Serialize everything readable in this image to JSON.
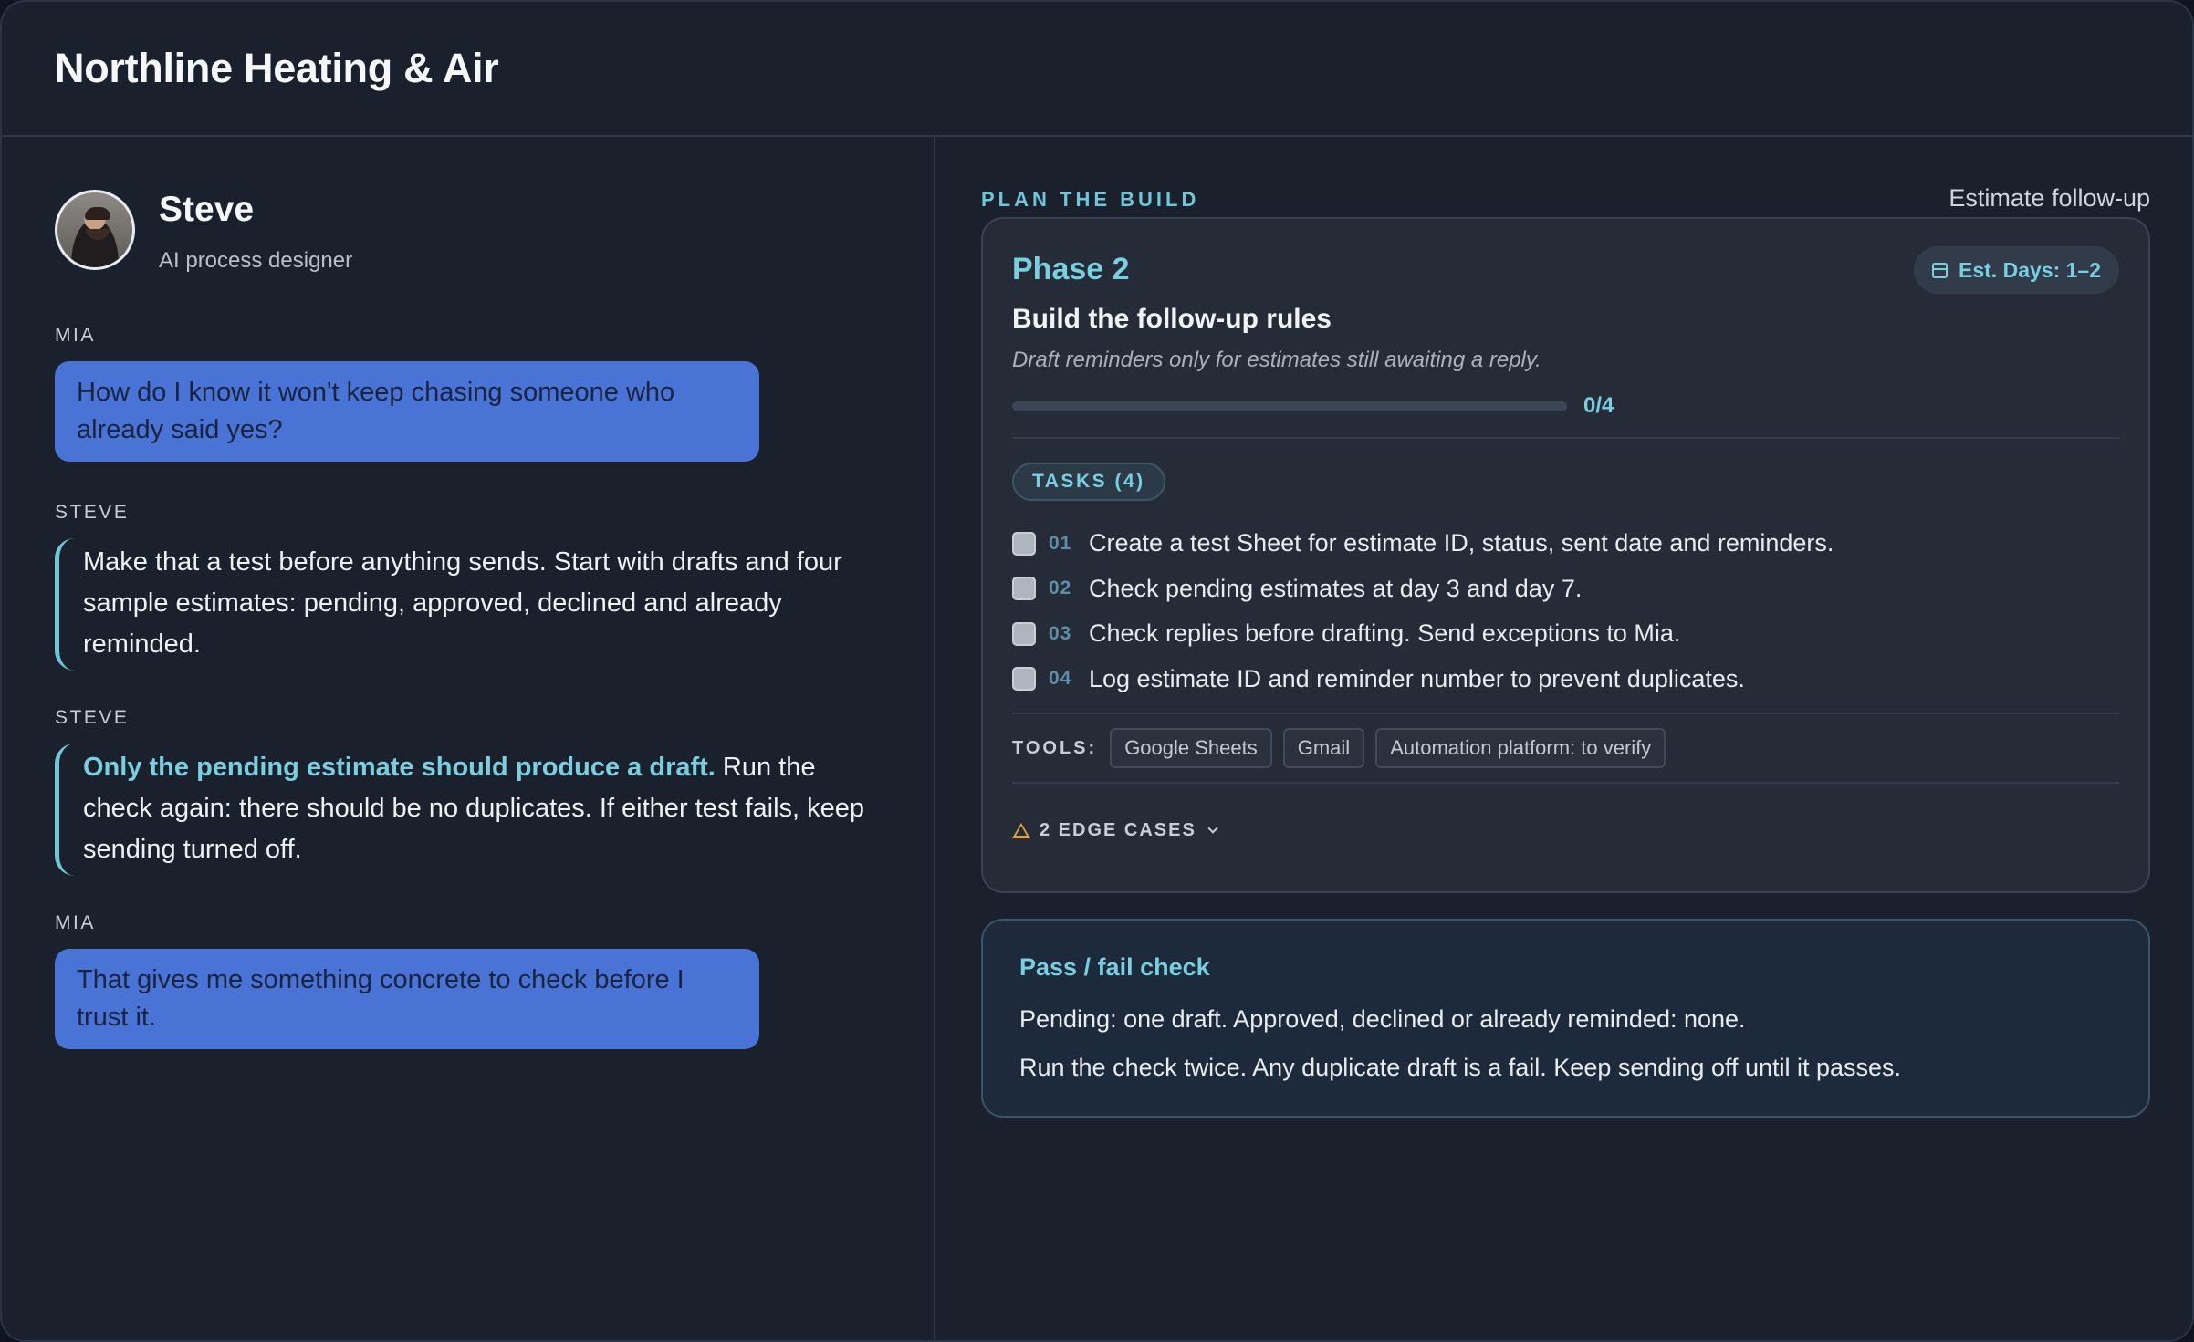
{
  "app": {
    "title": "Northline Heating & Air"
  },
  "profile": {
    "name": "Steve",
    "role": "AI process designer"
  },
  "conversation": [
    {
      "speaker": "MIA",
      "text": "How do I know it won't keep chasing someone who already said yes?"
    },
    {
      "speaker": "STEVE",
      "text": "Make that a test before anything sends. Start with drafts and four sample estimates: pending, approved, declined and already reminded."
    },
    {
      "speaker": "STEVE",
      "highlight": "Only the pending estimate should produce a draft.",
      "text": " Run the check again: there should be no duplicates. If either test fails, keep sending turned off."
    },
    {
      "speaker": "MIA",
      "text": "That gives me something concrete to check before I trust it."
    }
  ],
  "plan": {
    "label": "PLAN THE BUILD",
    "link": "Estimate follow-up",
    "phase": "Phase 2",
    "est_days": "Est. Days: 1–2",
    "subtitle": "Build the follow-up rules",
    "description": "Draft reminders only for estimates still awaiting a reply.",
    "progress_text": "0/4",
    "progress_fraction": 0,
    "tasks_label": "TASKS (4)",
    "tasks": [
      {
        "num": "01",
        "text": "Create a test Sheet for estimate ID, status, sent date and reminders."
      },
      {
        "num": "02",
        "text": "Check pending estimates at day 3 and day 7."
      },
      {
        "num": "03",
        "text": "Check replies before drafting. Send exceptions to Mia."
      },
      {
        "num": "04",
        "text": "Log estimate ID and reminder number to prevent duplicates."
      }
    ],
    "tools_label": "TOOLS:",
    "tools": [
      "Google Sheets",
      "Gmail",
      "Automation platform: to verify"
    ],
    "edge_cases": "2 EDGE CASES"
  },
  "check": {
    "title": "Pass / fail check",
    "line1": "Pending: one draft. Approved, declined or already reminded: none.",
    "line2": "Run the check twice. Any duplicate draft is a fail. Keep sending off until it passes."
  },
  "colors": {
    "accent": "#79cfe0",
    "user_bubble": "#4a73d6",
    "warning": "#e6a23c"
  },
  "icons": [
    "calendar-icon",
    "warning-icon",
    "chevron-down-icon"
  ]
}
